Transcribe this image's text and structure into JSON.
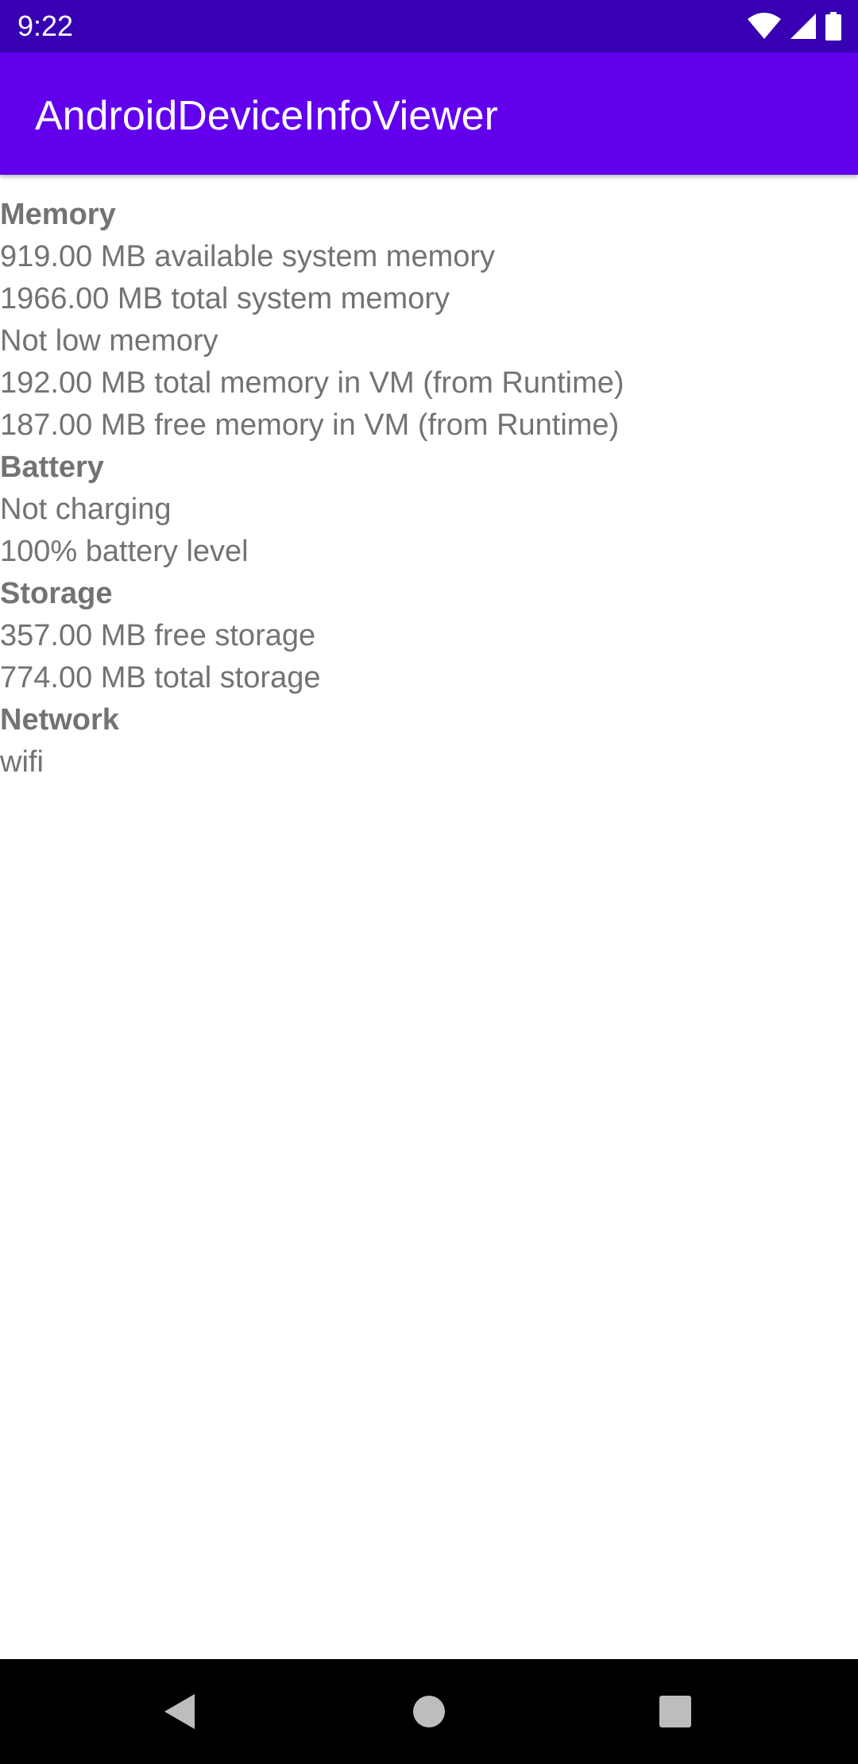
{
  "status_bar": {
    "time": "9:22",
    "icons": [
      "wifi-icon",
      "cellular-signal-icon",
      "battery-icon"
    ],
    "background": "#3700b3"
  },
  "app_bar": {
    "title": "AndroidDeviceInfoViewer",
    "background": "#6200ee"
  },
  "content": {
    "text_color": "#737373",
    "rows": [
      {
        "type": "heading",
        "text": "Memory"
      },
      {
        "type": "item",
        "text": "919.00 MB available system memory"
      },
      {
        "type": "item",
        "text": "1966.00 MB total system memory"
      },
      {
        "type": "item",
        "text": "Not low memory"
      },
      {
        "type": "item",
        "text": "192.00 MB total memory in VM (from Runtime)"
      },
      {
        "type": "item",
        "text": "187.00 MB free memory in VM (from Runtime)"
      },
      {
        "type": "heading",
        "text": "Battery"
      },
      {
        "type": "item",
        "text": "Not charging"
      },
      {
        "type": "item",
        "text": "100% battery level"
      },
      {
        "type": "heading",
        "text": "Storage"
      },
      {
        "type": "item",
        "text": "357.00 MB free storage"
      },
      {
        "type": "item",
        "text": "774.00 MB total storage"
      },
      {
        "type": "heading",
        "text": "Network"
      },
      {
        "type": "item",
        "text": "wifi"
      }
    ]
  },
  "nav_bar": {
    "buttons": [
      "back-icon",
      "home-icon",
      "recents-icon"
    ],
    "background": "#000000"
  }
}
